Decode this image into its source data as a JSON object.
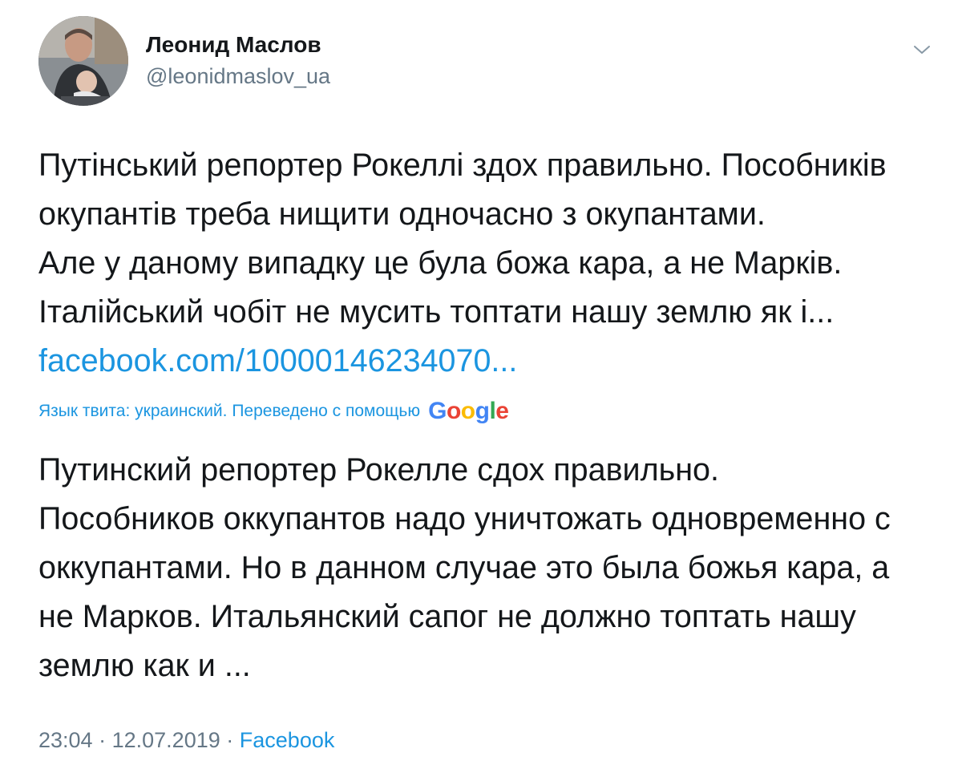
{
  "author": {
    "name": "Леонид Маслов",
    "handle": "@leonidmaslov_ua",
    "avatar_icon": "profile-photo"
  },
  "menu": {
    "icon": "chevron-down-icon"
  },
  "tweet": {
    "original_lines": [
      "Путінський репортер Рокеллі здох правильно. Пособників",
      "окупантів треба нищити одночасно з окупантами.",
      "Але у даному випадку це була божа кара, а не Марків.",
      "Італійський чобіт не мусить топтати нашу землю як і..."
    ],
    "link_text": "facebook.com/10000146234070..."
  },
  "translation": {
    "note": "Язык твита: украинский. Переведено с помощью",
    "provider": {
      "letters": [
        "G",
        "o",
        "o",
        "g",
        "l",
        "e"
      ]
    },
    "lines": [
      "Путинский репортер Рокелле сдох правильно.",
      "Пособников оккупантов надо уничтожать одновременно с",
      "оккупантами. Но в данном случае это была божья кара, а",
      "не Марков. Итальянский сапог не должно топтать нашу",
      "землю как и ..."
    ]
  },
  "meta": {
    "time": "23:04",
    "separator": "·",
    "date": "12.07.2019",
    "source": "Facebook"
  },
  "colors": {
    "link": "#1b95e0",
    "secondary_text": "#657786",
    "primary_text": "#14171a",
    "google_blue": "#4285f4",
    "google_red": "#ea4335",
    "google_yellow": "#fbbc05",
    "google_green": "#34a853"
  }
}
